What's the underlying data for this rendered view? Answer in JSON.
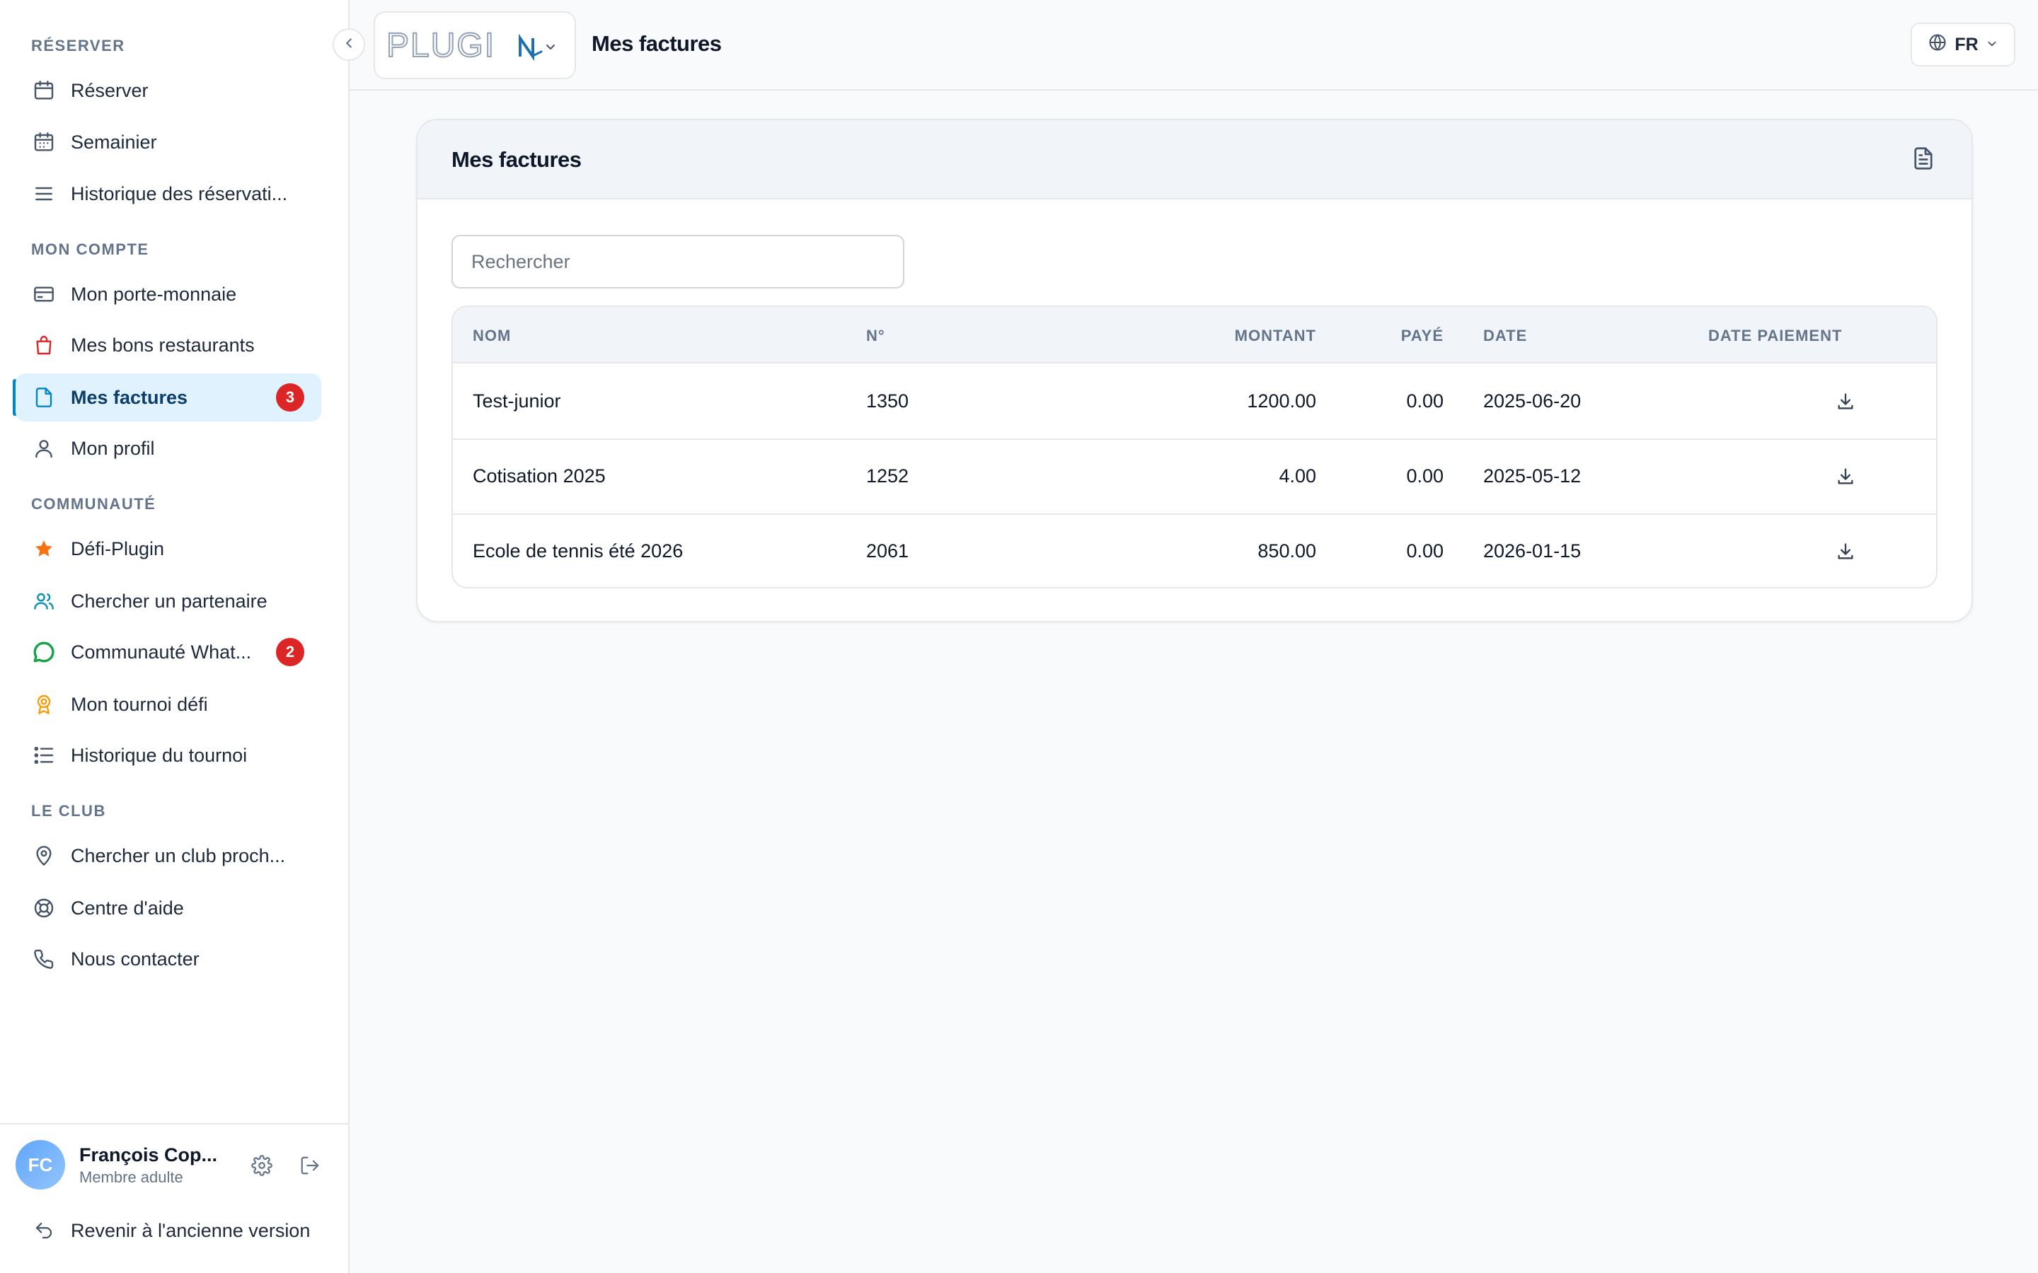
{
  "sidebar": {
    "sections": {
      "reserver": "RÉSERVER",
      "mon_compte": "MON COMPTE",
      "communaute": "COMMUNAUTÉ",
      "le_club": "LE CLUB"
    },
    "items": {
      "reserver": "Réserver",
      "semainier": "Semainier",
      "historique_reservations": "Historique des réservati...",
      "porte_monnaie": "Mon porte-monnaie",
      "bons_restaurants": "Mes bons restaurants",
      "factures": "Mes factures",
      "profil": "Mon profil",
      "defi_plugin": "Défi-Plugin",
      "chercher_partenaire": "Chercher un partenaire",
      "communaute_whatsapp": "Communauté What...",
      "tournoi_defi": "Mon tournoi défi",
      "historique_tournoi": "Historique du tournoi",
      "chercher_club": "Chercher un club proch...",
      "centre_aide": "Centre d'aide",
      "nous_contacter": "Nous contacter"
    },
    "badges": {
      "factures": "3",
      "communaute_whatsapp": "2"
    },
    "active_item": "Mes factures",
    "user": {
      "initials": "FC",
      "name": "François Cop...",
      "role": "Membre adulte"
    },
    "back_link": "Revenir à l'ancienne version"
  },
  "header": {
    "logo_text": "PLUGIN",
    "title": "Mes factures",
    "language": "FR"
  },
  "card": {
    "title": "Mes factures",
    "search_placeholder": "Rechercher"
  },
  "table": {
    "columns": {
      "nom": "NOM",
      "numero": "N°",
      "montant": "MONTANT",
      "paye": "PAYÉ",
      "date": "DATE",
      "date_paiement": "DATE PAIEMENT"
    },
    "rows": [
      {
        "nom": "Test-junior",
        "numero": "1350",
        "montant": "1200.00",
        "paye": "0.00",
        "date": "2025-06-20",
        "date_paiement": ""
      },
      {
        "nom": "Cotisation 2025",
        "numero": "1252",
        "montant": "4.00",
        "paye": "0.00",
        "date": "2025-05-12",
        "date_paiement": ""
      },
      {
        "nom": "Ecole de tennis été 2026",
        "numero": "2061",
        "montant": "850.00",
        "paye": "0.00",
        "date": "2026-01-15",
        "date_paiement": ""
      }
    ]
  },
  "colors": {
    "accent": "#0284c7",
    "active_bg": "#e0f2fe",
    "badge": "#dc2626",
    "star": "#f97316",
    "whatsapp": "#16a34a",
    "partner": "#0891b2",
    "bag": "#dc2626",
    "award": "#f59e0b"
  }
}
